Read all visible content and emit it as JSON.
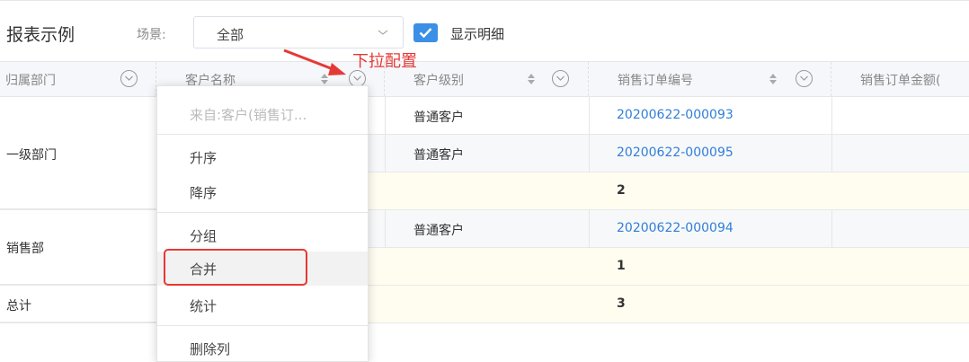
{
  "toolbar": {
    "title": "报表示例",
    "scene_label": "场景:",
    "scene_value": "全部",
    "show_detail_label": "显示明细",
    "show_detail_checked": true
  },
  "annotation": "下拉配置",
  "table": {
    "columns": [
      "归属部门",
      "客户名称",
      "客户级别",
      "销售订单编号",
      "销售订单金额("
    ],
    "rows": {
      "r1": {
        "level": "普通客户",
        "order": "20200622-000093"
      },
      "r2": {
        "dept": "一级部门",
        "level": "普通客户",
        "order": "20200622-000095"
      },
      "r3": {
        "count": "2"
      },
      "r4": {
        "dept": "销售部",
        "level": "普通客户",
        "order": "20200622-000094"
      },
      "r5": {
        "count": "1"
      },
      "r6": {
        "dept": "总计",
        "count": "3"
      }
    }
  },
  "menu": {
    "source": "来自:客户(销售订...",
    "asc": "升序",
    "desc": "降序",
    "group": "分组",
    "merge": "合并",
    "stat": "统计",
    "delete": "删除列"
  },
  "colors": {
    "accent": "#3b8fe6",
    "annotation": "#e53935",
    "link": "#2f7fd8",
    "subtotal_bg": "#fffdf0"
  }
}
